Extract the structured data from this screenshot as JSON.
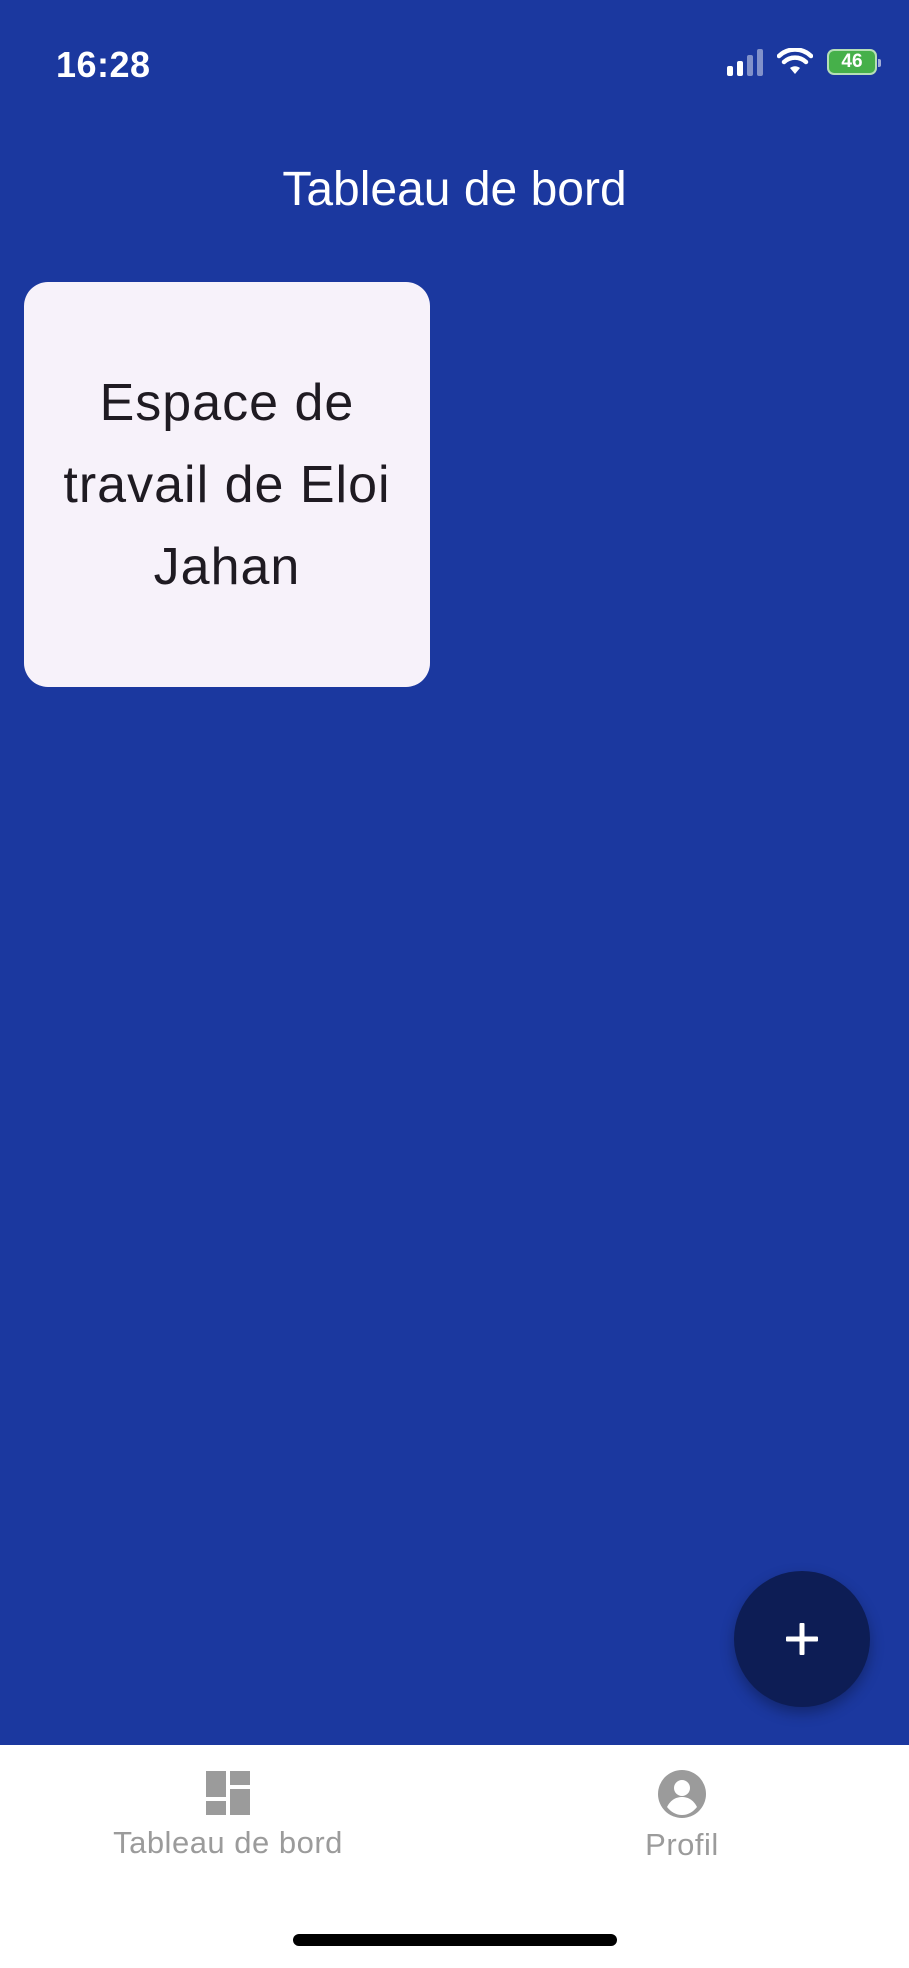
{
  "status_bar": {
    "time": "16:28",
    "battery_level": "46",
    "icons": [
      "signal-icon",
      "wifi-icon",
      "battery-charging-icon"
    ]
  },
  "header": {
    "title": "Tableau de bord"
  },
  "workspaces": [
    {
      "label": "Espace de travail de Eloi Jahan"
    }
  ],
  "fab": {
    "icon": "plus-icon"
  },
  "bottom_nav": {
    "items": [
      {
        "label": "Tableau de bord",
        "icon": "dashboard-icon"
      },
      {
        "label": "Profil",
        "icon": "account-circle-icon"
      }
    ]
  },
  "colors": {
    "background": "#1b389f",
    "card": "#f7f2fa",
    "fab": "#0d1d55",
    "nav_inactive": "#9b9b9b",
    "battery": "#46b04a"
  }
}
